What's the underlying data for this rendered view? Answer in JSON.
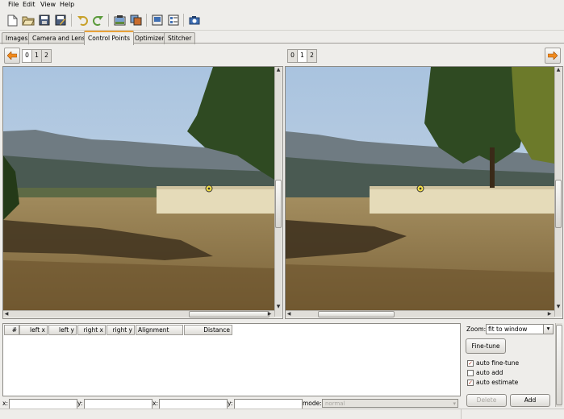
{
  "menubar": {
    "items": [
      "File",
      "Edit",
      "View",
      "Help"
    ]
  },
  "toolbar": {
    "buttons": [
      "new-file-icon",
      "open-folder-icon",
      "save-icon",
      "save-as-icon",
      "undo-icon",
      "redo-icon",
      "add-image-icon",
      "align-icon",
      "preview-icon",
      "properties-icon",
      "camera-icon"
    ]
  },
  "tabs": [
    "Images",
    "Camera and Lens",
    "Control Points",
    "Optimizer",
    "Stitcher"
  ],
  "active_tab": "Control Points",
  "left_nav": {
    "numbers": [
      "0",
      "1",
      "2"
    ],
    "selected": "0"
  },
  "right_nav": {
    "numbers": [
      "0",
      "1",
      "2"
    ],
    "selected": "1"
  },
  "table": {
    "columns": [
      "#",
      "left x",
      "left y",
      "right x",
      "right y",
      "Alignment",
      "Distance"
    ]
  },
  "fields": {
    "x1_label": "x:",
    "y1_label": "y:",
    "x2_label": "x:",
    "y2_label": "y:",
    "mode_label": "mode:",
    "mode_value": "normal"
  },
  "zoom": {
    "label": "Zoom:",
    "value": "fit to window"
  },
  "buttons": {
    "fine_tune": "Fine-tune",
    "delete": "Delete",
    "add": "Add"
  },
  "options": {
    "auto_fine_tune": {
      "label": "auto fine-tune",
      "checked": true
    },
    "auto_add": {
      "label": "auto add",
      "checked": false
    },
    "auto_estimate": {
      "label": "auto estimate",
      "checked": true
    }
  },
  "colors": {
    "accent_orange": "#f08a1c",
    "selected_tab_border": "#e8a23a"
  }
}
